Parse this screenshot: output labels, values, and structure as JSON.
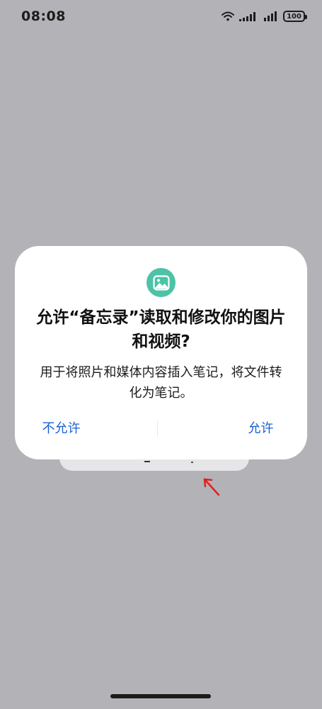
{
  "status_bar": {
    "time": "08:08",
    "battery": "100",
    "icons": [
      "wifi-icon",
      "signal-icon",
      "signal-icon",
      "battery-icon"
    ]
  },
  "dialog": {
    "icon": "image-icon",
    "icon_color": "#4dc2a7",
    "title": "允许“备忘录”读取和修改你的图片和视频?",
    "message": "用于将照片和媒体内容插入笔记，将文件转化为笔记。",
    "deny_label": "不允许",
    "allow_label": "允许",
    "button_color": "#1a5fd6"
  },
  "annotation": {
    "icon": "arrow-icon",
    "color": "#e02020"
  }
}
